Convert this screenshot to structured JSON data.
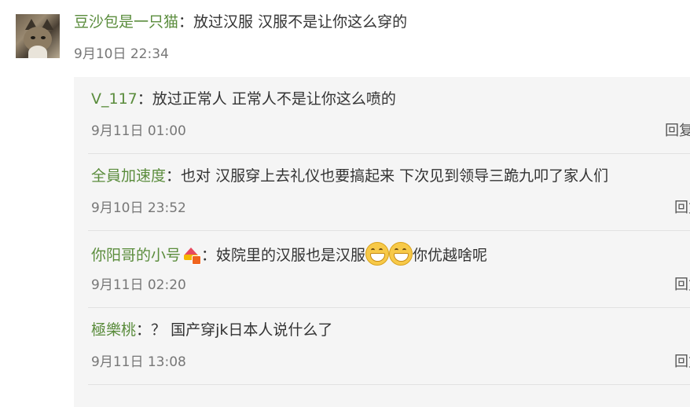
{
  "main_comment": {
    "username": "豆沙包是一只猫",
    "text": "放过汉服 汉服不是让你这么穿的",
    "time": "9月10日 22:34"
  },
  "colon": "：",
  "replies": [
    {
      "username": "V_117",
      "text": "放过正常人 正常人不是让你这么喷的",
      "time": "9月11日 01:00",
      "action": "回复"
    },
    {
      "username": "全員加速度",
      "text": "也对 汉服穿上去礼仪也要搞起来 下次见到领导三跪九叩了家人们",
      "time": "9月10日 23:52",
      "action": "回复"
    },
    {
      "username": "你阳哥的小号",
      "badge_icon": "vip-crown-badge-icon",
      "text_before": "妓院里的汉服也是汉服",
      "emoji": "grinning-face-icon",
      "text_after": "你优越啥呢",
      "time": "9月11日 02:20",
      "action": "回复"
    },
    {
      "username": "極樂桃",
      "text": "？ 国产穿jk日本人说什么了",
      "time": "9月11日 13:08",
      "action": "回复"
    }
  ],
  "colors": {
    "username": "#5a8c3c",
    "text": "#333333",
    "time": "#777777",
    "reply_bg": "#f5f5f5"
  }
}
